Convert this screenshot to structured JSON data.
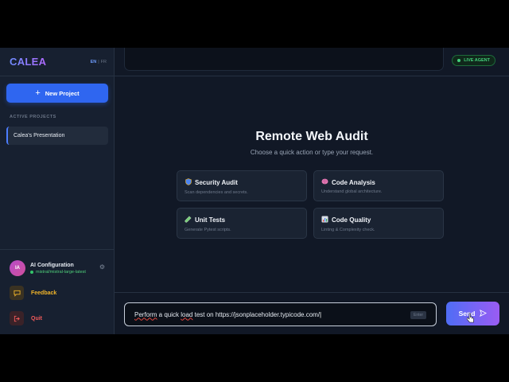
{
  "sidebar": {
    "brand": "CALEA",
    "lang_active": "EN",
    "lang_sep": "|",
    "lang_other": "FR",
    "new_project_label": "New Project",
    "section_label": "ACTIVE PROJECTS",
    "projects": [
      {
        "label": "Calea's Presentation"
      }
    ],
    "ai_config": {
      "avatar_initials": "IA",
      "title": "AI Configuration",
      "model": "mistral/mistral-large-latest"
    },
    "feedback_label": "Feedback",
    "quit_label": "Quit"
  },
  "topbar": {
    "status_badge": "LIVE AGENT",
    "status_color": "#43d07b"
  },
  "hero": {
    "title": "Remote Web Audit",
    "subtitle": "Choose a quick action or type your request."
  },
  "cards": [
    {
      "icon": "shield-icon",
      "title": "Security Audit",
      "desc": "Scan dependencies and secrets."
    },
    {
      "icon": "brain-icon",
      "title": "Code Analysis",
      "desc": "Understand global architecture."
    },
    {
      "icon": "test-tube-icon",
      "title": "Unit Tests",
      "desc": "Generate Pytest scripts."
    },
    {
      "icon": "bar-chart-icon",
      "title": "Code Quality",
      "desc": "Linting & Complexity check."
    }
  ],
  "composer": {
    "value_prefix": "Perform",
    "value_mid": " a quick ",
    "value_word": "load",
    "value_rest": " test on https://jsonplaceholder.typicode.com/",
    "enter_hint": "Enter",
    "send_label": "Send"
  },
  "colors": {
    "accent": "#2f66f0",
    "send_gradient_end": "#9a5cf3"
  }
}
